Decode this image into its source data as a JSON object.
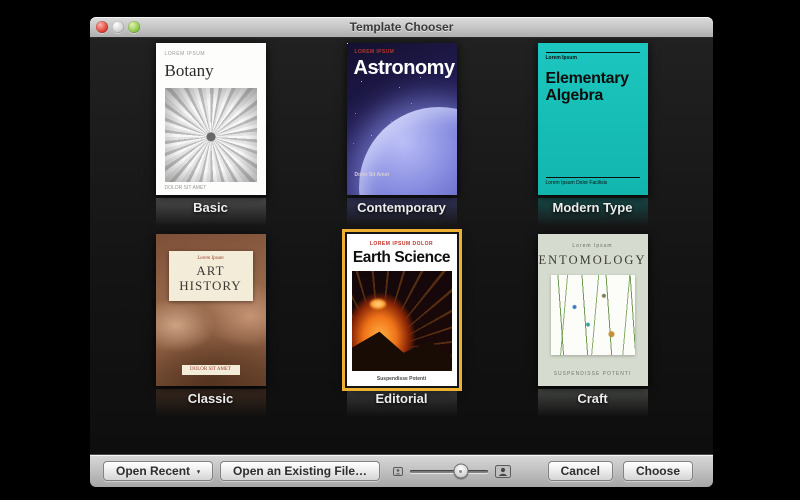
{
  "window": {
    "title": "Template Chooser"
  },
  "colors": {
    "selection_ring": "#edb031",
    "teal_cover": "#17c2ba",
    "content_background": "#141414",
    "chrome_gray": "#c2c2c2"
  },
  "icons": {
    "popup_arrow": "▾",
    "window_controls": [
      "close-icon",
      "minimize-icon",
      "zoom-icon"
    ],
    "slider_icons": [
      "small-thumbnail-icon",
      "large-thumbnail-icon"
    ]
  },
  "templates": [
    {
      "label": "Basic",
      "selected": false,
      "cover": {
        "top": "LOREM IPSUM",
        "title": "Botany",
        "bottom": "DOLOR SIT AMET"
      }
    },
    {
      "label": "Contemporary",
      "selected": false,
      "cover": {
        "top": "LOREM IPSUM",
        "title": "Astronomy",
        "bottom": "Dolor Sit Amet"
      }
    },
    {
      "label": "Modern Type",
      "selected": false,
      "cover": {
        "top": "Lorem Ipsum",
        "title": "Elementary Algebra",
        "bottom": "Lorem Ipsum Dolor Facilisis"
      }
    },
    {
      "label": "Classic",
      "selected": false,
      "cover": {
        "top": "Lorem Ipsum",
        "title": "ART HISTORY",
        "bottom": "DOLOR SIT AMET"
      }
    },
    {
      "label": "Editorial",
      "selected": true,
      "cover": {
        "top": "LOREM IPSUM DOLOR",
        "title": "Earth Science",
        "bottom": "Suspendisse Potenti"
      }
    },
    {
      "label": "Craft",
      "selected": false,
      "cover": {
        "top": "Lorem Ipsum",
        "title": "ENTOMOLOGY",
        "bottom": "SUSPENDISSE POTENTI"
      }
    }
  ],
  "toolbar": {
    "open_recent_label": "Open Recent",
    "open_existing_label": "Open an Existing File…",
    "cancel_label": "Cancel",
    "choose_label": "Choose",
    "zoom_slider_percent": 65
  }
}
